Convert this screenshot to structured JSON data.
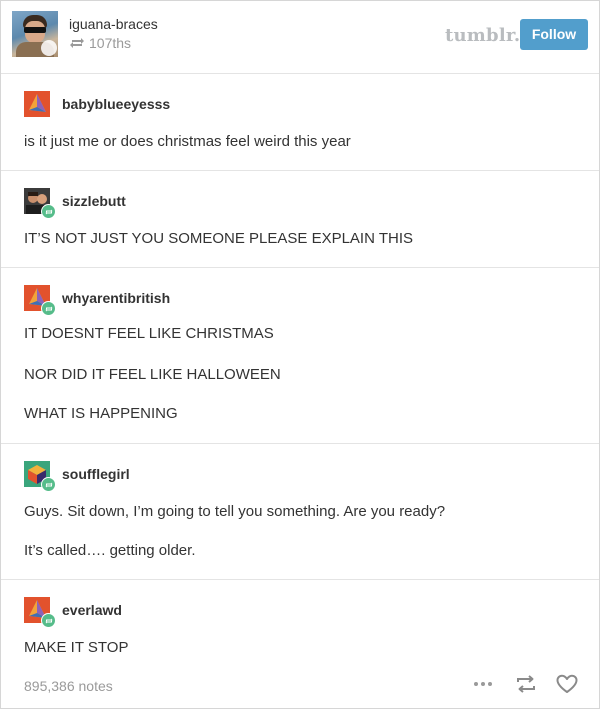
{
  "header": {
    "username": "iguana-braces",
    "reblogged_from": "107ths",
    "logo_text": "tumblr.",
    "follow_label": "Follow"
  },
  "posts": [
    {
      "username": "babyblueeyesss",
      "avatar": "pyramid-avatar",
      "paragraphs": [
        "is it just me or does christmas feel weird this year"
      ]
    },
    {
      "username": "sizzlebutt",
      "avatar": "photo-avatar",
      "paragraphs": [
        "IT’S NOT JUST YOU SOMEONE PLEASE EXPLAIN THIS"
      ]
    },
    {
      "username": "whyarentibritish",
      "avatar": "pyramid-avatar",
      "paragraphs": [
        "IT DOESNT FEEL LIKE CHRISTMAS",
        "NOR DID IT FEEL LIKE HALLOWEEN",
        "WHAT IS HAPPENING"
      ]
    },
    {
      "username": "soufflegirl",
      "avatar": "cube-avatar",
      "paragraphs": [
        "Guys. Sit down, I’m going to tell you something. Are you ready?",
        "It’s called…. getting older."
      ]
    },
    {
      "username": "everlawd",
      "avatar": "pyramid-avatar",
      "paragraphs": [
        "MAKE IT STOP"
      ]
    }
  ],
  "footer": {
    "notes": "895,386 notes",
    "icons": [
      "more-icon",
      "reblog-icon",
      "heart-icon"
    ]
  },
  "colors": {
    "follow_button": "#529ecc",
    "reblog_badge": "#56bc8a",
    "pyramid_avatar": "#e2522d",
    "logo": "#b9bcbf"
  }
}
